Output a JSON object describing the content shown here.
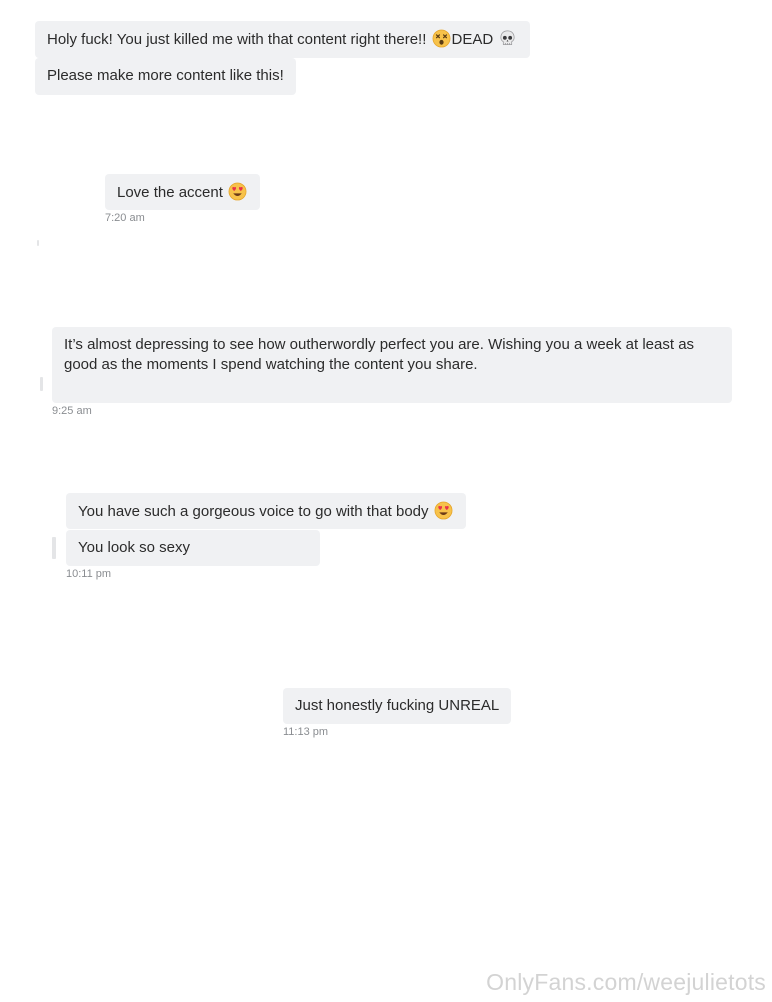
{
  "thread": {
    "group1": {
      "msg1": {
        "text_before": "Holy fuck! You just killed me with that content right there!!",
        "emoji1": "dizzy-face-emoji",
        "text_after": "DEAD",
        "emoji2": "skull-emoji"
      },
      "msg2": {
        "text": "Please make more content like this!"
      }
    },
    "group2": {
      "msg1": {
        "text": "Love the accent",
        "emoji": "heart-eyes-emoji"
      },
      "time": "7:20 am"
    },
    "group3": {
      "msg1": {
        "text": "It’s almost depressing to see how outherwordly perfect you are. Wishing you a week at least as good as the moments I spend watching the content you share."
      },
      "time": "9:25 am"
    },
    "group4": {
      "msg1": {
        "text": "You have such a gorgeous voice to go with that body",
        "emoji": "heart-eyes-emoji"
      },
      "msg2": {
        "text": "You look so sexy"
      },
      "time": "10:11 pm"
    },
    "group5": {
      "msg1": {
        "text": "Just honestly fucking UNREAL"
      },
      "time": "11:13 pm"
    }
  },
  "watermark": {
    "text": "OnlyFans.com/weejulietots"
  },
  "colors": {
    "bubble_bg": "#f0f1f3",
    "text": "#2b2b2b",
    "timestamp": "#8a8d91",
    "watermark": "#d3d3d3"
  }
}
